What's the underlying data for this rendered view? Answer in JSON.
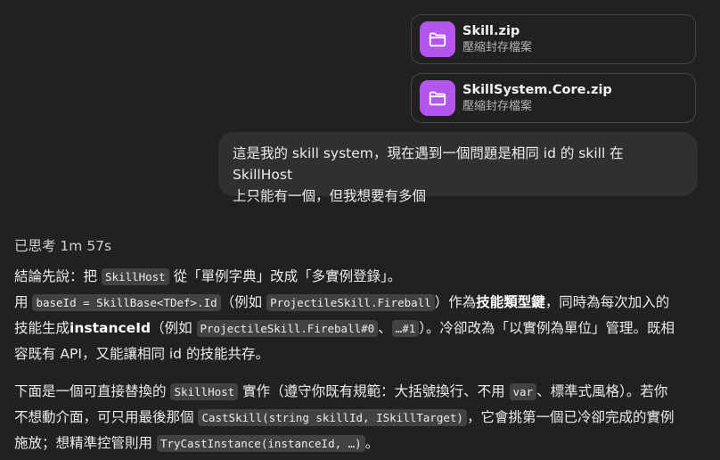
{
  "attachments": [
    {
      "name": "Skill.zip",
      "type": "壓縮封存檔案",
      "icon": "folder-icon"
    },
    {
      "name": "SkillSystem.Core.zip",
      "type": "壓縮封存檔案",
      "icon": "folder-icon"
    }
  ],
  "colors": {
    "background": "#212121",
    "bubble": "#303030",
    "file_icon": "#b455ee",
    "code_bg": "#424242"
  },
  "user_message": {
    "line1": "這是我的 skill system，現在遇到一個問題是相同 id 的 skill 在 SkillHost",
    "line2": "上只能有一個，但我想要有多個"
  },
  "assistant": {
    "thought_label": "已思考 1m 57s",
    "p1": {
      "l1_a": "結論先說：把 ",
      "l1_code": "SkillHost",
      "l1_b": " 從「單例字典」改成「多實例登錄」。",
      "l2_a": "用 ",
      "l2_code1": "baseId = SkillBase<TDef>.Id",
      "l2_b": "（例如 ",
      "l2_code2": "ProjectileSkill.Fireball",
      "l2_c": "）作為",
      "l2_strong": "技能類型鍵",
      "l2_d": "，同時為每次加入的",
      "l3_a": "技能生成",
      "l3_strong": "instanceId",
      "l3_b": "（例如 ",
      "l3_code1": "ProjectileSkill.Fireball#0",
      "l3_c": "、",
      "l3_code2": "…#1",
      "l3_d": "）。冷卻改為「以實例為單位」管理。既相",
      "l4": "容既有 API，又能讓相同 id 的技能共存。"
    },
    "p2": {
      "l1_a": "下面是一個可直接替換的 ",
      "l1_code1": "SkillHost",
      "l1_b": " 實作（遵守你既有規範：大括號換行、不用 ",
      "l1_code2": "var",
      "l1_c": "、標準式風格）。若你",
      "l2_a": "不想動介面，可只用最後那個 ",
      "l2_code": "CastSkill(string skillId, ISkillTarget)",
      "l2_b": "，它會挑第一個已冷卻完成的實例",
      "l3_a": "施放；想精準控管則用 ",
      "l3_code": "TryCastInstance(instanceId, …)",
      "l3_b": "。"
    }
  }
}
